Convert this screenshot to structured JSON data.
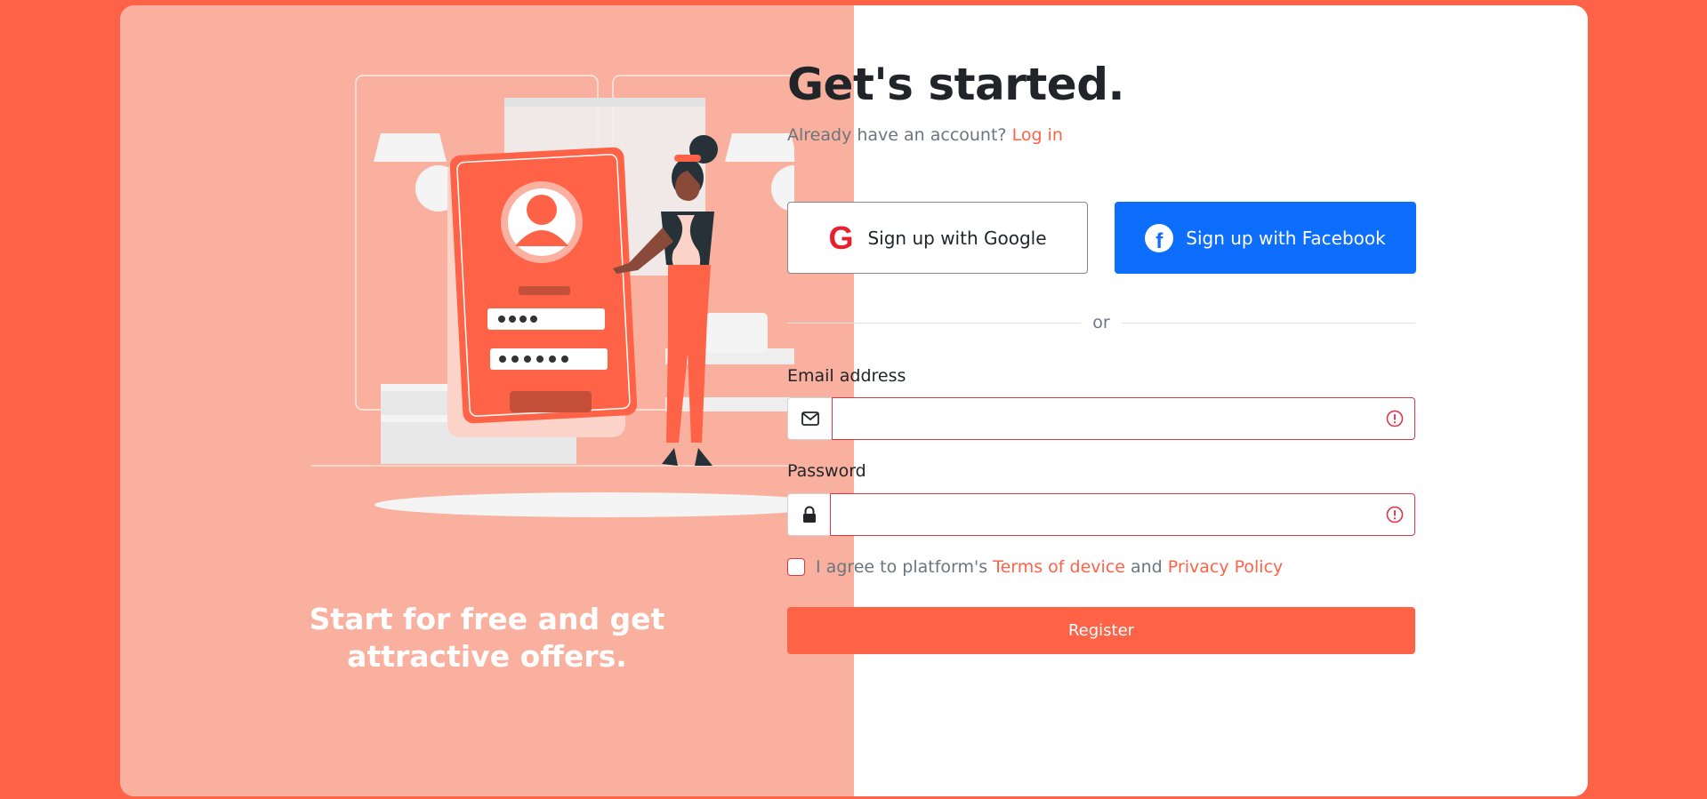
{
  "theme": {
    "accent": "#FF6347",
    "left_panel_bg": "#F9B09E",
    "facebook_blue": "#0D6EFD",
    "error": "#dc3545"
  },
  "left": {
    "tagline_line1": "Start for free and get",
    "tagline_line2": "attractive offers."
  },
  "header": {
    "title": "Get's started.",
    "subtitle_text": "Already have an account?",
    "login_link": "Log in"
  },
  "social": {
    "google_label": "Sign up with Google",
    "facebook_label": "Sign up with Facebook",
    "google_icon": "google-g-icon",
    "facebook_icon": "facebook-icon"
  },
  "divider_text": "or",
  "form": {
    "email_label": "Email address",
    "email_value": "",
    "email_icon": "envelope-icon",
    "password_label": "Password",
    "password_value": "",
    "password_icon": "lock-icon",
    "agree_prefix": "I agree to platform's",
    "terms_link": "Terms of device",
    "agree_and": "and",
    "privacy_link": "Privacy Policy",
    "register_label": "Register"
  }
}
